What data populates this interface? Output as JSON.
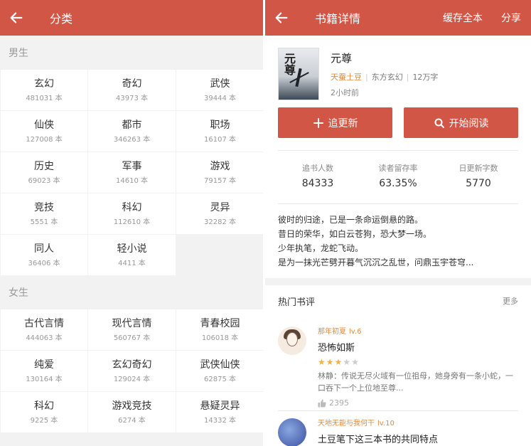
{
  "left": {
    "header": {
      "title": "分类"
    },
    "male": {
      "label": "男生",
      "items": [
        {
          "name": "玄幻",
          "count": "481031 本"
        },
        {
          "name": "奇幻",
          "count": "43973 本"
        },
        {
          "name": "武侠",
          "count": "39444 本"
        },
        {
          "name": "仙侠",
          "count": "127008 本"
        },
        {
          "name": "都市",
          "count": "346263 本"
        },
        {
          "name": "职场",
          "count": "16107 本"
        },
        {
          "name": "历史",
          "count": "69023 本"
        },
        {
          "name": "军事",
          "count": "14610 本"
        },
        {
          "name": "游戏",
          "count": "79157 本"
        },
        {
          "name": "竞技",
          "count": "5551 本"
        },
        {
          "name": "科幻",
          "count": "112610 本"
        },
        {
          "name": "灵异",
          "count": "32282 本"
        },
        {
          "name": "同人",
          "count": "36406 本"
        },
        {
          "name": "轻小说",
          "count": "4411 本"
        }
      ]
    },
    "female": {
      "label": "女生",
      "items": [
        {
          "name": "古代言情",
          "count": "444063 本"
        },
        {
          "name": "现代言情",
          "count": "560767 本"
        },
        {
          "name": "青春校园",
          "count": "106018 本"
        },
        {
          "name": "纯爱",
          "count": "130164 本"
        },
        {
          "name": "玄幻奇幻",
          "count": "129024 本"
        },
        {
          "name": "武侠仙侠",
          "count": "62875 本"
        },
        {
          "name": "科幻",
          "count": "9225 本"
        },
        {
          "name": "游戏竞技",
          "count": "6274 本"
        },
        {
          "name": "悬疑灵异",
          "count": "14332 本"
        }
      ]
    }
  },
  "right": {
    "header": {
      "title": "书籍详情",
      "cache_all": "缓存全本",
      "share": "分享"
    },
    "book": {
      "cover_text": "元尊",
      "title": "元尊",
      "author": "天蚕土豆",
      "genre": "东方玄幻",
      "words": "12万字",
      "updated": "2小时前"
    },
    "buttons": {
      "follow": "追更新",
      "read": "开始阅读"
    },
    "stats": [
      {
        "label": "追书人数",
        "value": "84333"
      },
      {
        "label": "读者留存率",
        "value": "63.35%"
      },
      {
        "label": "日更新字数",
        "value": "5770"
      }
    ],
    "intro": [
      "彼时的归途，已是一条命运倒悬的路。",
      "昔日的荣华，如白云苍狗，恐大梦一场。",
      "少年执笔，龙蛇飞动。",
      "是为一抹光芒劈开暮气沉沉之乱世，问鼎玉宇苍穹..."
    ],
    "hot_reviews": {
      "title": "热门书评",
      "more": "更多",
      "items": [
        {
          "user": "那年初夏",
          "level": "lv.6",
          "title": "恐怖如斯",
          "rating": 3,
          "text": "林静：传说无尽火域有一位祖母，她身旁有一条小蛇，一口吞下一个上位地至尊...",
          "likes": "2395"
        },
        {
          "user": "天地无能与我何干",
          "level": "lv.10",
          "title": "土豆笔下这三本书的共同特点"
        }
      ]
    }
  },
  "colors": {
    "accent": "#d25645",
    "author": "#e08a3c",
    "star": "#f0b24c"
  }
}
